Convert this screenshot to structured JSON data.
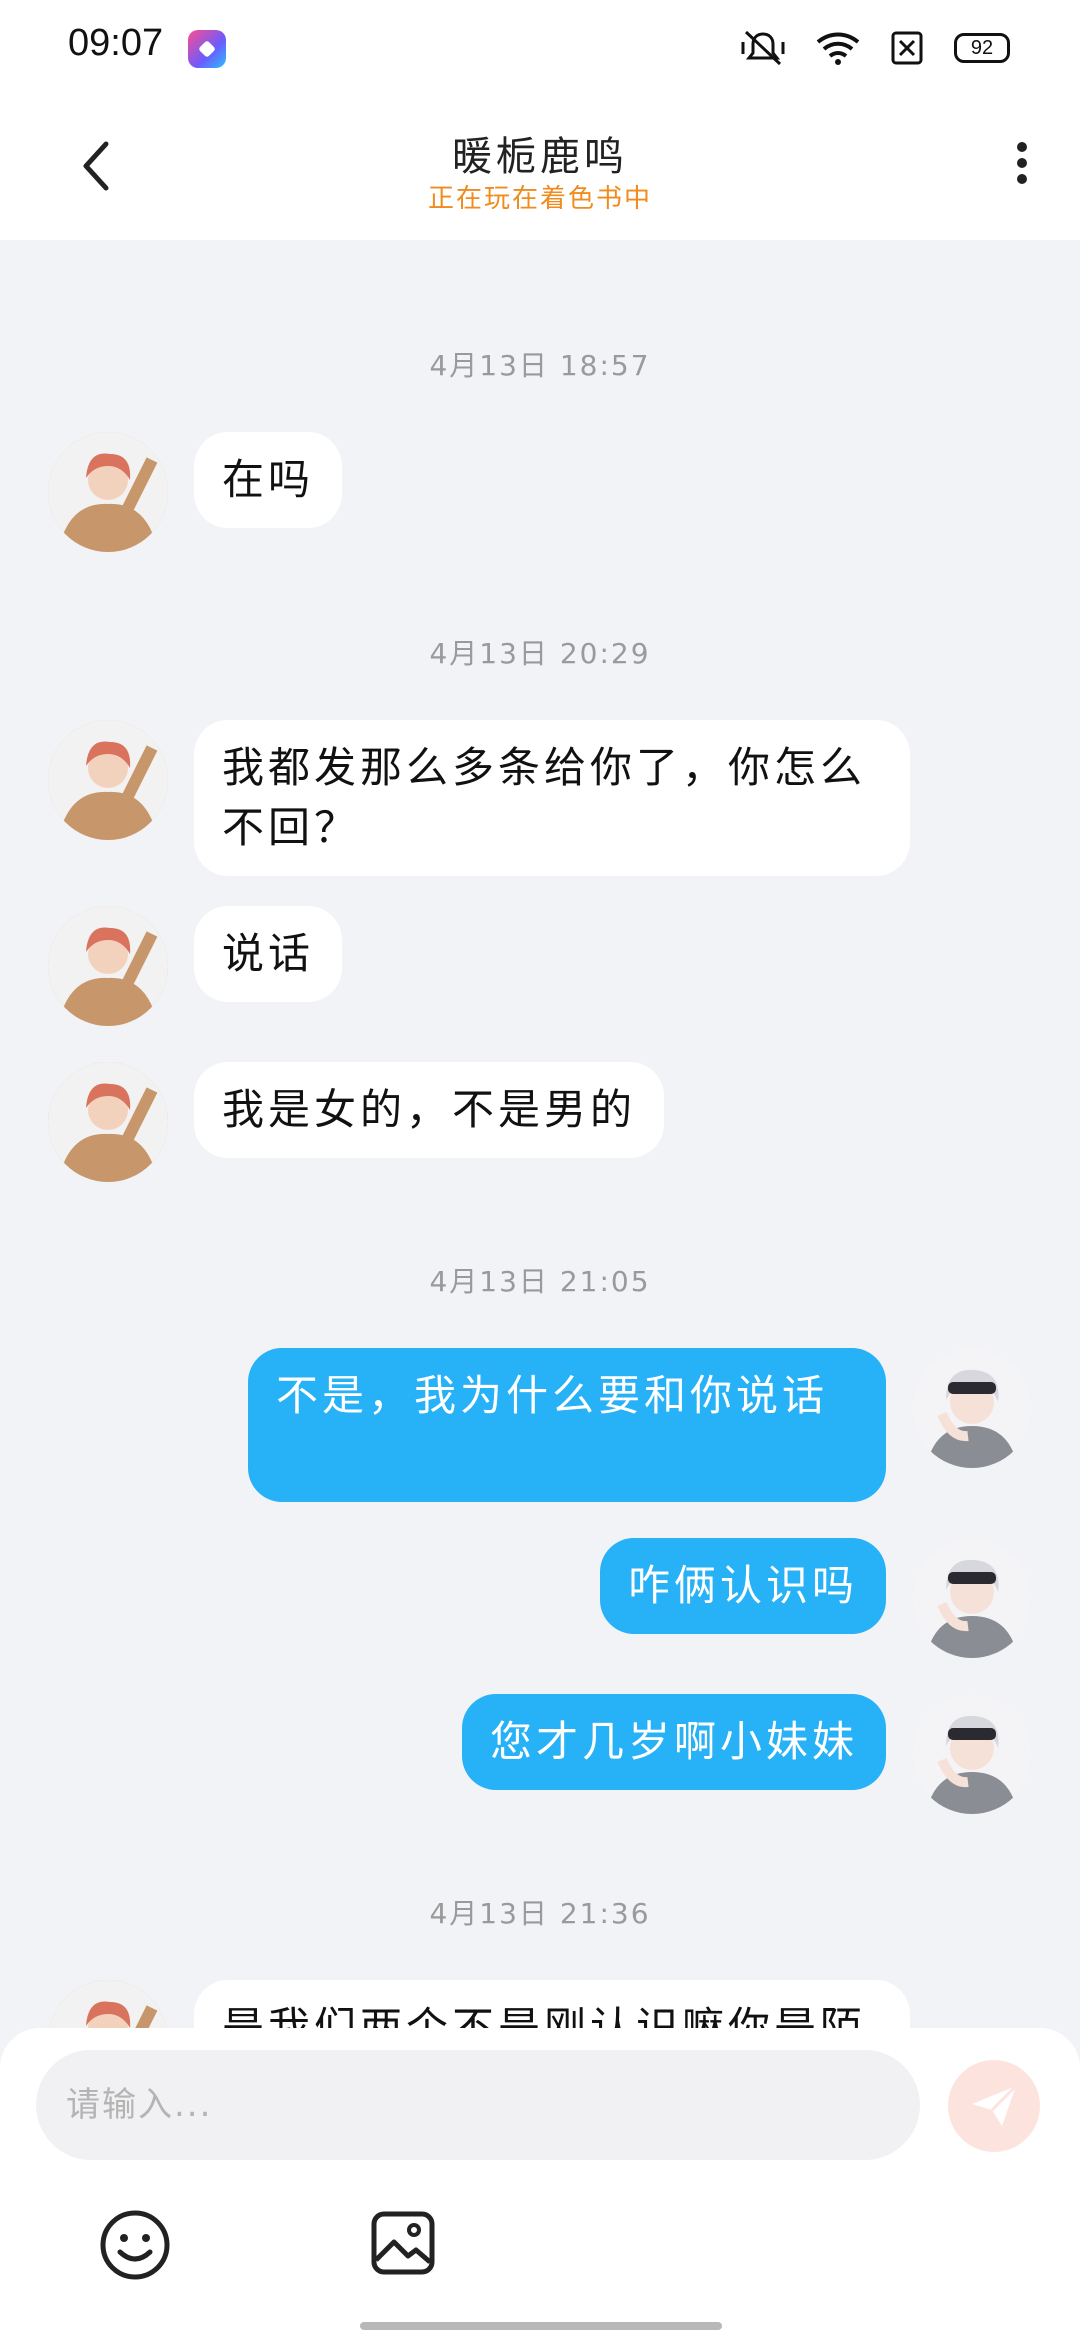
{
  "status_bar": {
    "time": "09:07",
    "battery": "92",
    "icons": [
      "app-badge-icon",
      "mute-vibrate-icon",
      "wifi-icon",
      "sim-off-icon",
      "battery-icon"
    ]
  },
  "header": {
    "title": "暖栀鹿鸣",
    "subtitle": "正在玩在着色书中",
    "back_icon": "chevron-left-icon",
    "more_icon": "more-vertical-icon"
  },
  "chat": {
    "timestamps": [
      "4月13日 18:57",
      "4月13日 20:29",
      "4月13日 21:05",
      "4月13日 21:36"
    ],
    "messages": [
      {
        "from": "other",
        "text": "在吗"
      },
      {
        "from": "other",
        "text": "我都发那么多条给你了，你怎么不回？"
      },
      {
        "from": "other",
        "text": "说话"
      },
      {
        "from": "other",
        "text": "我是女的，不是男的"
      },
      {
        "from": "self",
        "text": "不是，我为什么要和你说话"
      },
      {
        "from": "self",
        "text": "咋俩认识吗"
      },
      {
        "from": "self",
        "text": "您才几岁啊小妹妹"
      },
      {
        "from": "other",
        "text": "是我们两个不是刚认识嘛你是陌"
      }
    ]
  },
  "composer": {
    "placeholder": "请输入...",
    "send_icon": "send-icon",
    "emoji_icon": "smiley-icon",
    "image_icon": "image-icon"
  },
  "colors": {
    "self_bubble": "#27b1f6",
    "other_bubble": "#ffffff",
    "subtitle": "#f08b1d",
    "background": "#f2f3f7"
  }
}
